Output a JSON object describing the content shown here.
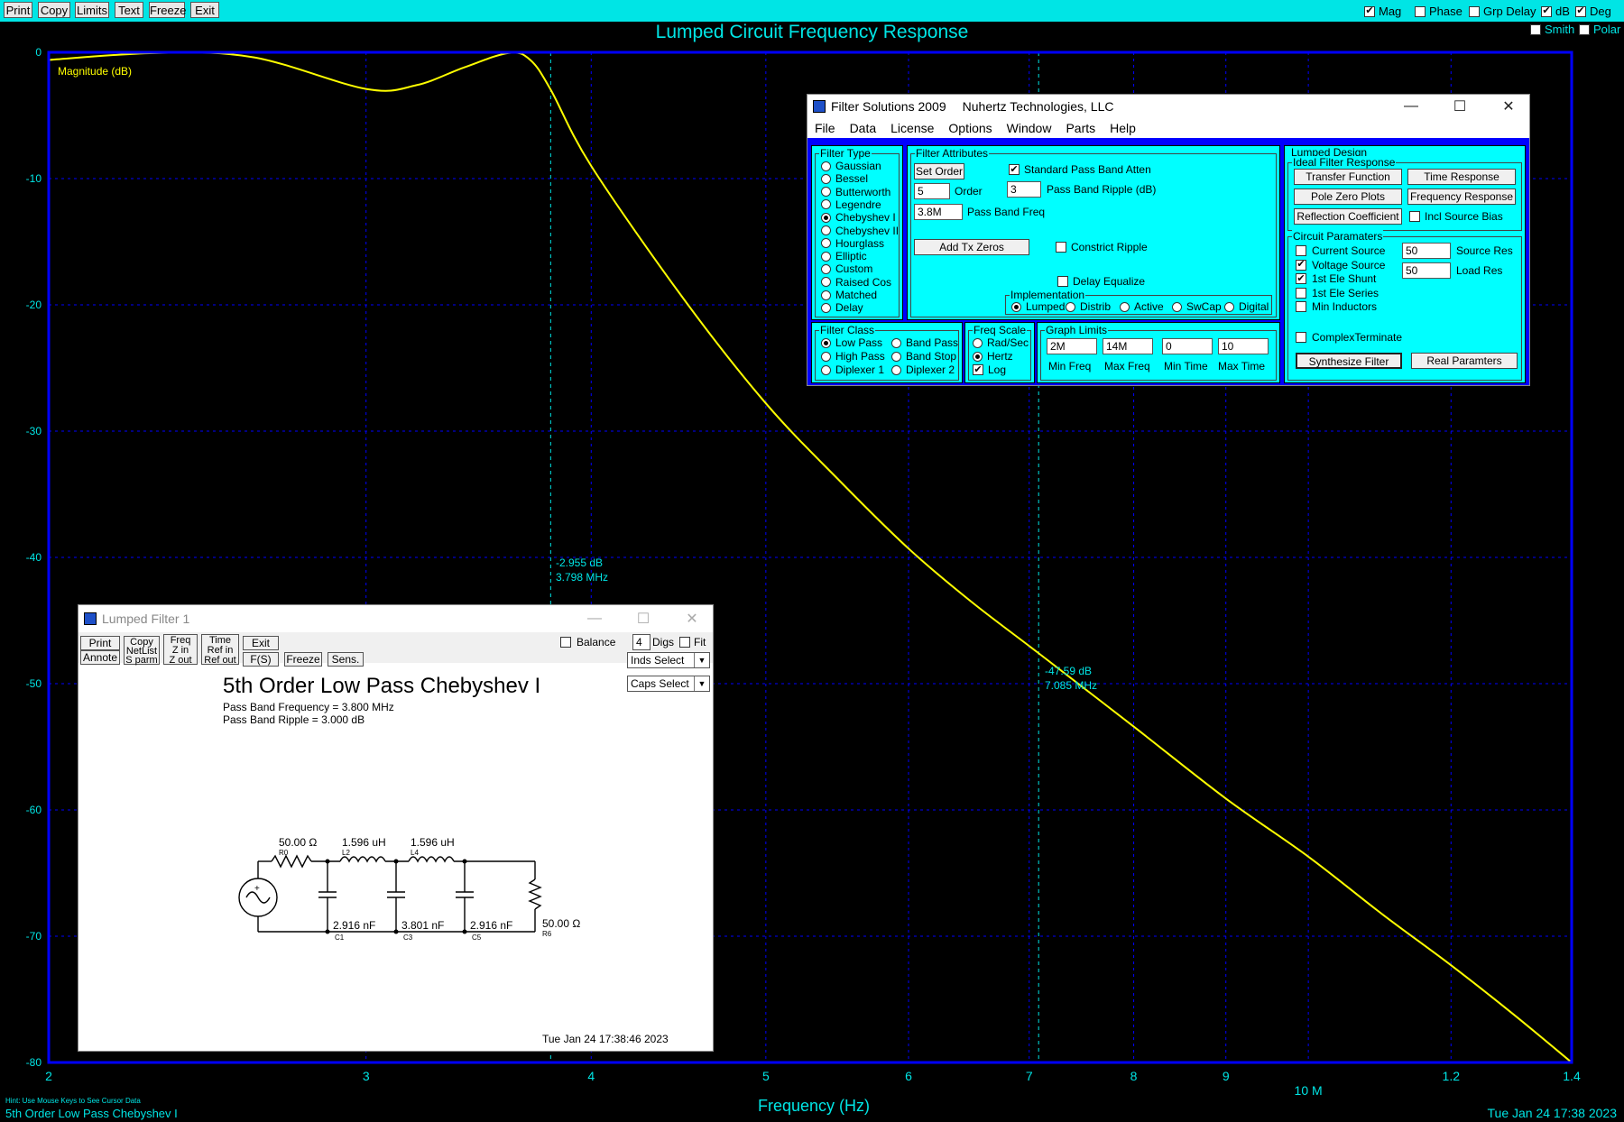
{
  "toolbar": {
    "buttons": [
      "Print",
      "Copy",
      "Limits",
      "Text",
      "Freeze",
      "Exit"
    ],
    "checks": [
      {
        "label": "Mag",
        "checked": true
      },
      {
        "label": "Phase",
        "checked": false
      },
      {
        "label": "Grp Delay",
        "checked": false
      },
      {
        "label": "dB",
        "checked": true
      },
      {
        "label": "Deg",
        "checked": true
      },
      {
        "label": "Smith",
        "checked": false
      },
      {
        "label": "Polar",
        "checked": false
      }
    ]
  },
  "plot": {
    "title": "Lumped Circuit Frequency Response",
    "xlabel": "Frequency (Hz)",
    "trace_label": "Magnitude (dB)",
    "hint": "Hint: Use Mouse Keys to See Cursor Data",
    "footer_left": "5th Order Low Pass Chebyshev I",
    "footer_right": "Tue Jan 24 17:38 2023",
    "cursor1": {
      "db": "-2.955 dB",
      "freq": "3.798 MHz"
    },
    "cursor2": {
      "db": "-47.59 dB",
      "freq": "7.085 MHz"
    },
    "colors": {
      "background": "#000000",
      "frame": "#0000ff",
      "grid": "#0000ff",
      "trace": "#ffff00",
      "text": "#00e5e5"
    }
  },
  "chart_data": {
    "type": "line",
    "title": "Lumped Circuit Frequency Response",
    "xlabel": "Frequency (Hz)",
    "ylabel": "Magnitude (dB)",
    "x_scale": "log",
    "xlim": [
      2000000,
      14000000
    ],
    "ylim": [
      -80,
      0
    ],
    "yticks": [
      0,
      -10,
      -20,
      -30,
      -40,
      -50,
      -60,
      -70,
      -80
    ],
    "xticks": [
      {
        "value": 2000000,
        "label": "2"
      },
      {
        "value": 3000000,
        "label": "3"
      },
      {
        "value": 4000000,
        "label": "4"
      },
      {
        "value": 5000000,
        "label": "5"
      },
      {
        "value": 6000000,
        "label": "6"
      },
      {
        "value": 7000000,
        "label": "7"
      },
      {
        "value": 8000000,
        "label": "8"
      },
      {
        "value": 9000000,
        "label": "9"
      },
      {
        "value": 10000000,
        "label": "10 M"
      },
      {
        "value": 12000000,
        "label": "1.2"
      },
      {
        "value": 14000000,
        "label": "1.4"
      }
    ],
    "series": [
      {
        "name": "Magnitude (dB)",
        "x": [
          2000000,
          2300000,
          2600000,
          3000000,
          3200000,
          3400000,
          3600000,
          3700000,
          3798000,
          4000000,
          4500000,
          5000000,
          5500000,
          6000000,
          6500000,
          7085000,
          8000000,
          9000000,
          10000000,
          11000000,
          12000000,
          13000000,
          14000000
        ],
        "y": [
          -0.6,
          -0.05,
          -0.4,
          -2.9,
          -2.6,
          -1.2,
          -0.05,
          -0.6,
          -2.955,
          -9.0,
          -19.5,
          -27.8,
          -34.0,
          -39.3,
          -43.5,
          -47.59,
          -53.4,
          -59.1,
          -63.7,
          -68.3,
          -72.3,
          -76.2,
          -80.0
        ]
      }
    ],
    "cursors": [
      {
        "x": 3798000,
        "y": -2.955
      },
      {
        "x": 7085000,
        "y": -47.59
      }
    ],
    "grid": true
  },
  "fs": {
    "title": "Filter Solutions 2009",
    "company": "Nuhertz Technologies, LLC",
    "menu": [
      "File",
      "Data",
      "License",
      "Options",
      "Window",
      "Parts",
      "Help"
    ],
    "filter_type": {
      "title": "Filter Type",
      "options": [
        "Gaussian",
        "Bessel",
        "Butterworth",
        "Legendre",
        "Chebyshev I",
        "Chebyshev II",
        "Hourglass",
        "Elliptic",
        "Custom",
        "Raised Cos",
        "Matched",
        "Delay"
      ],
      "selected": 4
    },
    "attributes": {
      "title": "Filter Attributes",
      "set_order": "Set Order",
      "std_pass_band": "Standard Pass Band Atten",
      "order_value": "5",
      "order_label": "Order",
      "ripple_value": "3",
      "ripple_label": "Pass Band Ripple (dB)",
      "freq_value": "3.8M",
      "freq_label": "Pass Band Freq",
      "add_tx_zeros": "Add Tx Zeros",
      "constrict_ripple": "Constrict Ripple",
      "delay_equalize": "Delay Equalize",
      "implementation_title": "Implementation",
      "implementation": [
        "Lumped",
        "Distrib",
        "Active",
        "SwCap",
        "Digital"
      ]
    },
    "filter_class": {
      "title": "Filter Class",
      "options": [
        "Low Pass",
        "Band Pass",
        "High Pass",
        "Band Stop",
        "Diplexer 1",
        "Diplexer 2"
      ]
    },
    "freq_scale": {
      "title": "Freq Scale",
      "options": [
        "Rad/Sec",
        "Hertz"
      ],
      "log": "Log"
    },
    "graph_limits": {
      "title": "Graph Limits",
      "values": [
        "2M",
        "14M",
        "0",
        "10"
      ],
      "labels": [
        "Min Freq",
        "Max Freq",
        "Min Time",
        "Max Time"
      ]
    },
    "lumped_design": {
      "title": "Lumped Design",
      "ideal_title": "Ideal Filter Response",
      "buttons": [
        "Transfer Function",
        "Time Response",
        "Pole Zero Plots",
        "Frequency Response",
        "Reflection Coefficient"
      ],
      "incl_source_bias": "Incl Source Bias",
      "circuit_title": "Circuit Paramaters",
      "circuit_checks": [
        {
          "label": "Current Source",
          "checked": false
        },
        {
          "label": "Voltage Source",
          "checked": true
        },
        {
          "label": "1st Ele Shunt",
          "checked": true
        },
        {
          "label": "1st Ele Series",
          "checked": false
        },
        {
          "label": "Min Inductors",
          "checked": false
        }
      ],
      "source_res_value": "50",
      "source_res_label": "Source Res",
      "load_res_value": "50",
      "load_res_label": "Load Res",
      "complex_terminate": "ComplexTerminate",
      "synthesize": "Synthesize Filter",
      "real_params": "Real Paramters"
    }
  },
  "lf": {
    "title": "Lumped Filter 1",
    "buttons": {
      "print": "Print",
      "annote": "Annote",
      "copy": "Copy",
      "netlist": "NetList",
      "sparm": "S parm",
      "freq": "Freq",
      "zin": "Z in",
      "zout": "Z out",
      "time": "Time",
      "refin": "Ref in",
      "refout": "Ref out",
      "exit": "Exit",
      "fs": "F(S)",
      "freeze": "Freeze",
      "sens": "Sens."
    },
    "balance": "Balance",
    "digs_value": "4",
    "digs_label": "Digs",
    "fit": "Fit",
    "inds_select": "Inds Select",
    "caps_select": "Caps Select",
    "heading": "5th Order Low Pass Chebyshev I",
    "line1": "Pass Band Frequency = 3.800 MHz",
    "line2": "Pass Band Ripple = 3.000 dB",
    "components": {
      "r0_val": "50.00 Ω",
      "r0": "R0",
      "l2_val": "1.596 uH",
      "l2": "L2",
      "l4_val": "1.596 uH",
      "l4": "L4",
      "c1_val": "2.916 nF",
      "c1": "C1",
      "c3_val": "3.801 nF",
      "c3": "C3",
      "c5_val": "2.916 nF",
      "c5": "C5",
      "r6_val": "50.00 Ω",
      "r6": "R6"
    },
    "date": "Tue Jan 24 17:38:46 2023"
  }
}
